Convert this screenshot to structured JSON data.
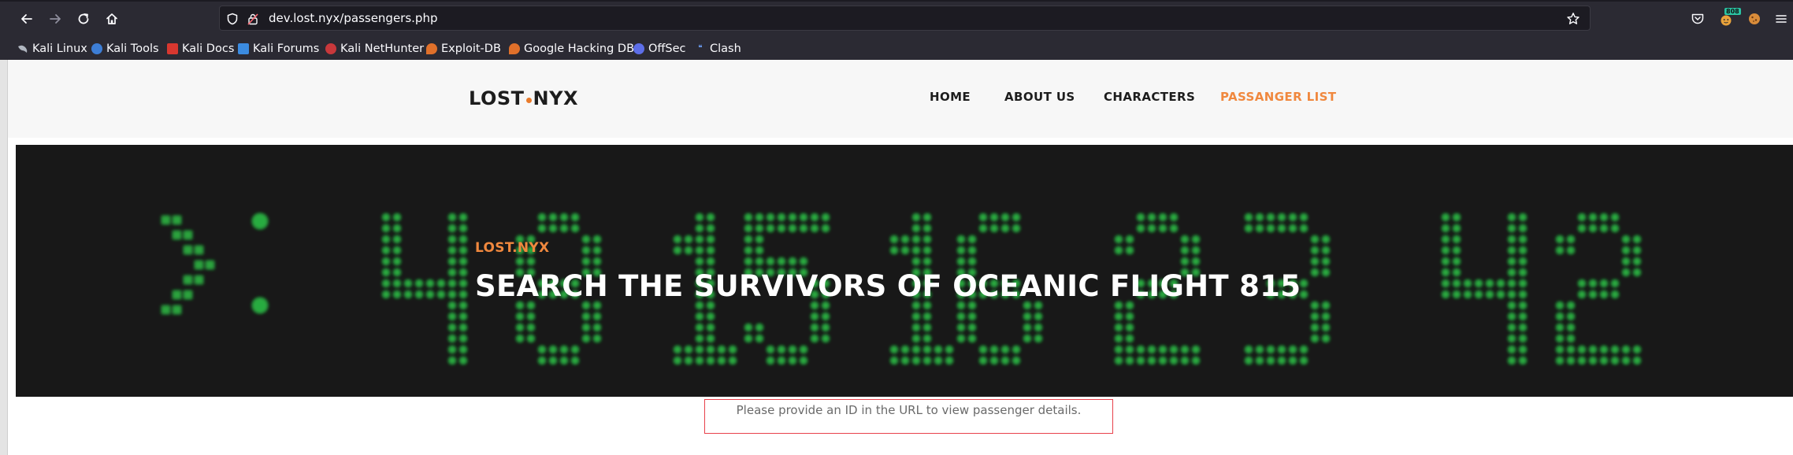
{
  "browser": {
    "url": "dev.lost.nyx/passengers.php",
    "extension_badge": "808",
    "bookmarks": [
      {
        "label": "Kali Linux",
        "icon": "kali-dragon-icon"
      },
      {
        "label": "Kali Tools",
        "icon": "kali-tools-icon"
      },
      {
        "label": "Kali Docs",
        "icon": "kali-docs-icon"
      },
      {
        "label": "Kali Forums",
        "icon": "kali-forums-icon"
      },
      {
        "label": "Kali NetHunter",
        "icon": "kali-nethunter-icon"
      },
      {
        "label": "Exploit-DB",
        "icon": "exploit-db-icon"
      },
      {
        "label": "Google Hacking DB",
        "icon": "ghdb-icon"
      },
      {
        "label": "OffSec",
        "icon": "offsec-icon"
      },
      {
        "label": "Clash",
        "icon": "clash-icon"
      }
    ]
  },
  "site": {
    "logo_part1": "LOST",
    "logo_part2": "NYX",
    "nav": [
      "HOME",
      "ABOUT US",
      "CHARACTERS",
      "PASSANGER LIST"
    ],
    "active_nav": "PASSANGER LIST"
  },
  "hero": {
    "kicker": "LOST.NYX",
    "title": "SEARCH THE SURVIVORS OF OCEANIC FLIGHT 815",
    "background_digits": ">: 4 8 15 16 23 42"
  },
  "message": {
    "text": "Please provide an ID in the URL to view passenger details."
  },
  "colors": {
    "accent": "#f0883e",
    "led": "#2fd14a",
    "error_border": "#e8414b"
  }
}
